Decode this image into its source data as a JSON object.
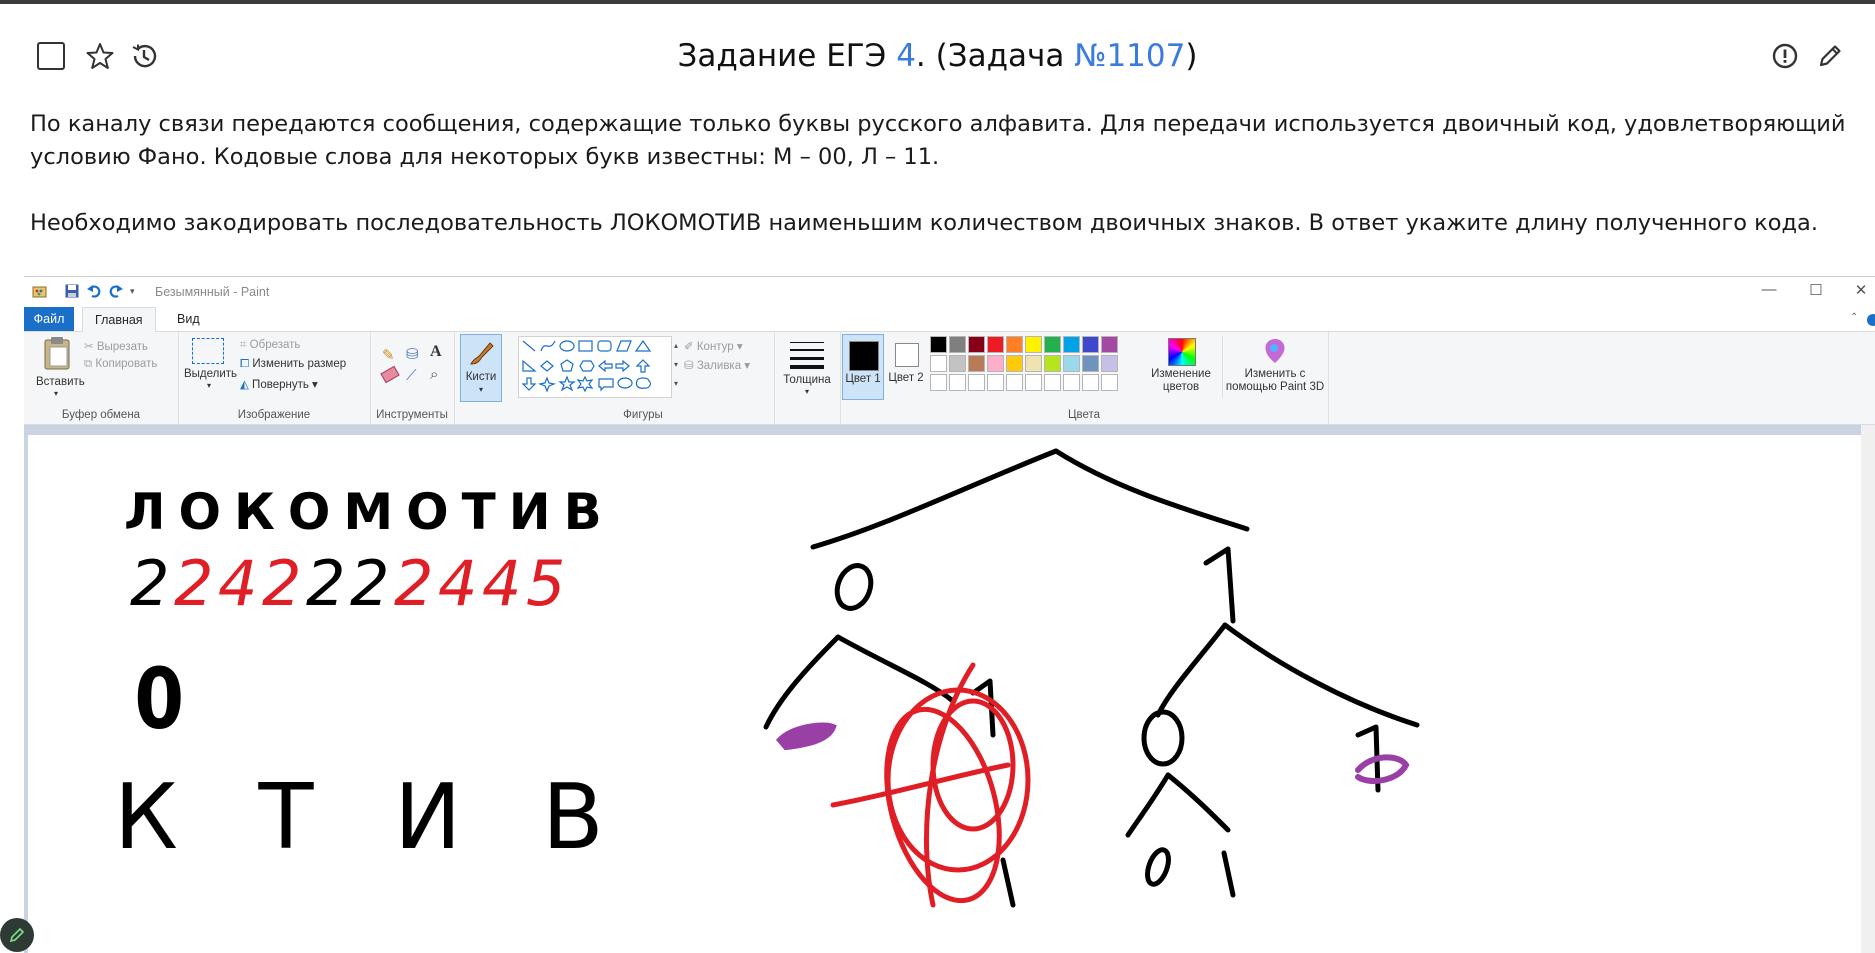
{
  "header": {
    "title_prefix": "Задание ЕГЭ ",
    "task_number": "4",
    "title_middle": ". (Задача ",
    "problem_id": "№1107",
    "title_suffix": ")",
    "icons": [
      "checkbox-icon",
      "star-icon",
      "history-icon",
      "report-icon",
      "edit-icon"
    ]
  },
  "task": {
    "paragraph1": "По каналу связи передаются сообщения, содержащие только буквы русского алфавита. Для передачи используется двоичный код, удовлетворяющий условию Фано. Кодовые слова для некоторых букв известны: М – 00, Л – 11.",
    "paragraph2": "Необходимо закодировать последовательность ЛОКОМОТИВ наименьшим количеством двоичных знаков. В ответ укажите длину полученного кода."
  },
  "paint": {
    "window_title": "Безымянный - Paint",
    "tabs": {
      "file": "Файл",
      "home": "Главная",
      "view": "Вид"
    },
    "clipboard": {
      "paste": "Вставить",
      "cut": "Вырезать",
      "copy": "Копировать",
      "group": "Буфер обмена"
    },
    "image": {
      "select": "Выделить",
      "crop": "Обрезать",
      "resize": "Изменить размер",
      "rotate": "Повернуть",
      "group": "Изображение"
    },
    "tools": {
      "group": "Инструменты"
    },
    "brushes": {
      "label": "Кисти"
    },
    "shapes": {
      "outline": "Контур",
      "fill": "Заливка",
      "group": "Фигуры"
    },
    "size": {
      "label": "Толщина"
    },
    "colors": {
      "color1": "Цвет 1",
      "color2": "Цвет 2",
      "edit": "Изменение цветов",
      "paint3d": "Изменить с помощью Paint 3D",
      "group": "Цвета",
      "palette_row1": [
        "#000000",
        "#7f7f7f",
        "#880015",
        "#ed1c24",
        "#ff7f27",
        "#fff200",
        "#22b14c",
        "#00a2e8",
        "#3f48cc",
        "#a349a4"
      ],
      "palette_row2": [
        "#ffffff",
        "#c3c3c3",
        "#b97a57",
        "#ffaec9",
        "#ffc90e",
        "#efe4b0",
        "#b5e61d",
        "#99d9ea",
        "#7092be",
        "#c8bfe7"
      ],
      "palette_row3": [
        "#ffffff",
        "#ffffff",
        "#ffffff",
        "#ffffff",
        "#ffffff",
        "#ffffff",
        "#ffffff",
        "#ffffff",
        "#ffffff",
        "#ffffff"
      ]
    },
    "drawing": {
      "word": "ЛОКОМОТИВ",
      "digits": [
        "2",
        "2",
        "4",
        "2",
        "2",
        "2",
        "2",
        "4",
        "4",
        "5"
      ],
      "zero": "0",
      "letters": "К Т И В",
      "tree_left": "0",
      "tree_right": "1"
    }
  }
}
